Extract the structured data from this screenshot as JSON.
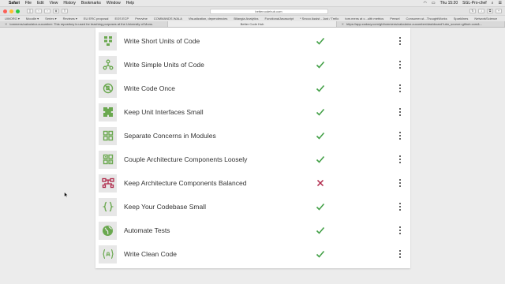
{
  "menubar": {
    "app": "Safari",
    "items": [
      "File",
      "Edit",
      "View",
      "History",
      "Bookmarks",
      "Window",
      "Help"
    ],
    "clock": "Thu 15:20",
    "user": "SGL-Pro-chef"
  },
  "toolbar": {
    "url": "bettercodehub.com"
  },
  "bookmarks": [
    "UWORG ▾",
    "Moodle ▾",
    "Series ▾",
    "Reviews ▾",
    "EU ERC proposal",
    "EOS ECP",
    "Prevvine",
    "COMMANDS WALA",
    "Visualization, dependencies",
    "Bllangia Analytics",
    "FunctionalJavascript",
    "* Secco Assist - Just / Trello",
    "tom.mens at c...ulth metrics",
    "Pensel",
    "Consumer-st...ThoughtWorks",
    "Sparklines",
    "NetworkScience"
  ],
  "tabs": [
    {
      "label": "tommens/calculator-cucumber: This repository is used for teaching purposes at the University of Mons.",
      "active": false
    },
    {
      "label": "Better Code Hub",
      "active": true
    },
    {
      "label": "https://app.codacy.com/gh/tommens/calculator-cucumber/dashboard?utm_source=github.com&...",
      "active": false
    }
  ],
  "guidelines": [
    {
      "label": "Write Short Units of Code",
      "status": "pass",
      "icon": "short-units-icon"
    },
    {
      "label": "Write Simple Units of Code",
      "status": "pass",
      "icon": "simple-units-icon"
    },
    {
      "label": "Write Code Once",
      "status": "pass",
      "icon": "code-once-icon"
    },
    {
      "label": "Keep Unit Interfaces Small",
      "status": "pass",
      "icon": "puzzle-icon"
    },
    {
      "label": "Separate Concerns in Modules",
      "status": "pass",
      "icon": "modules-icon"
    },
    {
      "label": "Couple Architecture Components Loosely",
      "status": "pass",
      "icon": "components-icon"
    },
    {
      "label": "Keep Architecture Components Balanced",
      "status": "fail",
      "icon": "balance-icon"
    },
    {
      "label": "Keep Your Codebase Small",
      "status": "pass",
      "icon": "braces-icon"
    },
    {
      "label": "Automate Tests",
      "status": "pass",
      "icon": "globe-icon"
    },
    {
      "label": "Write Clean Code",
      "status": "pass",
      "icon": "clean-code-icon"
    }
  ],
  "colors": {
    "pass": "#43a047",
    "fail": "#b0284a",
    "icon_green": "#6aa84f"
  }
}
